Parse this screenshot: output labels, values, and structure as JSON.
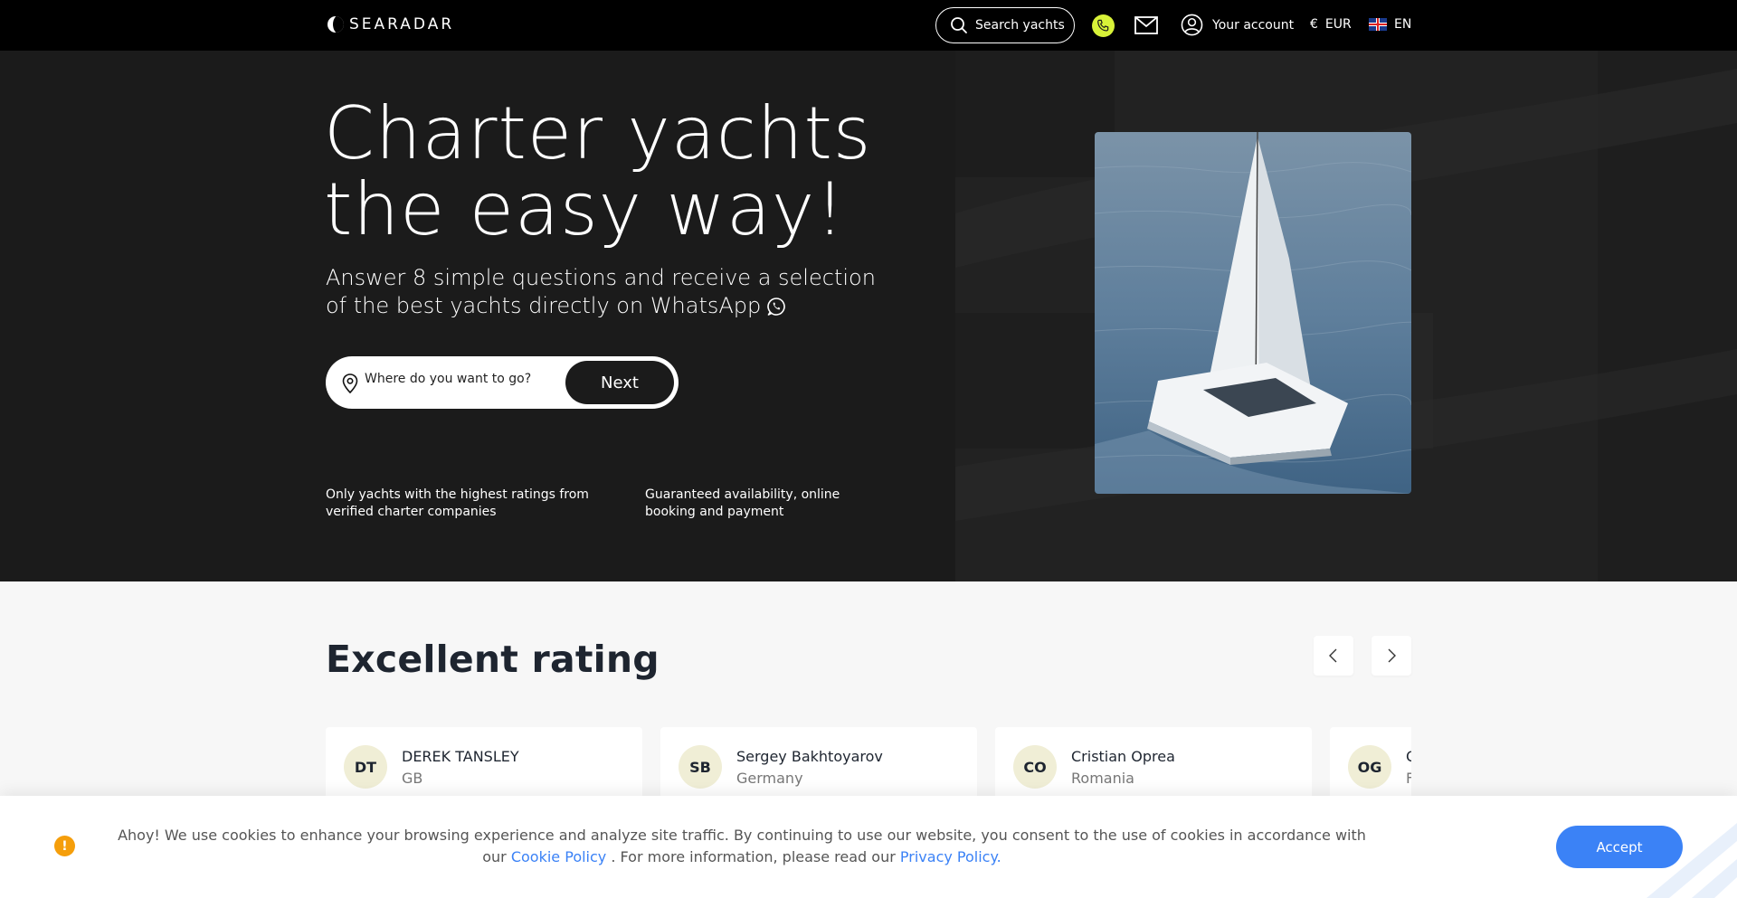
{
  "nav": {
    "logo_text": "SEARADAR",
    "search_label": "Search yachts",
    "account_label": "Your account",
    "currency_symbol": "€",
    "currency": "EUR",
    "language": "EN",
    "phone_color": "#d8f238"
  },
  "hero": {
    "title_line1": "Charter yachts",
    "title_line2": "the easy way!",
    "subtitle": "Answer 8 simple questions and receive a selection of the best yachts directly on WhatsApp",
    "destination_placeholder": "Where do you want to go?",
    "next_label": "Next",
    "feature_1": "Only yachts with the highest ratings from verified charter companies",
    "feature_2": "Guaranteed availability, online booking and payment"
  },
  "ratings": {
    "title": "Excellent rating",
    "reviews": [
      {
        "initials": "DT",
        "name": "DEREK TANSLEY",
        "country": "GB"
      },
      {
        "initials": "SB",
        "name": "Sergey Bakhtoyarov",
        "country": "Germany"
      },
      {
        "initials": "CO",
        "name": "Cristian Oprea",
        "country": "Romania"
      },
      {
        "initials": "OG",
        "name": "O",
        "country": "F"
      }
    ]
  },
  "cookie": {
    "icon_glyph": "!",
    "text_before": "Ahoy! We use cookies to enhance your browsing experience and analyze site traffic. By continuing to use our website, you consent to the use of cookies in accordance with our",
    "cookie_policy_link": "Cookie Policy",
    "text_middle": ". For more information, please read our",
    "privacy_policy_link": "Privacy Policy.",
    "accept_label": "Accept",
    "accent_color": "#3b82f6"
  }
}
